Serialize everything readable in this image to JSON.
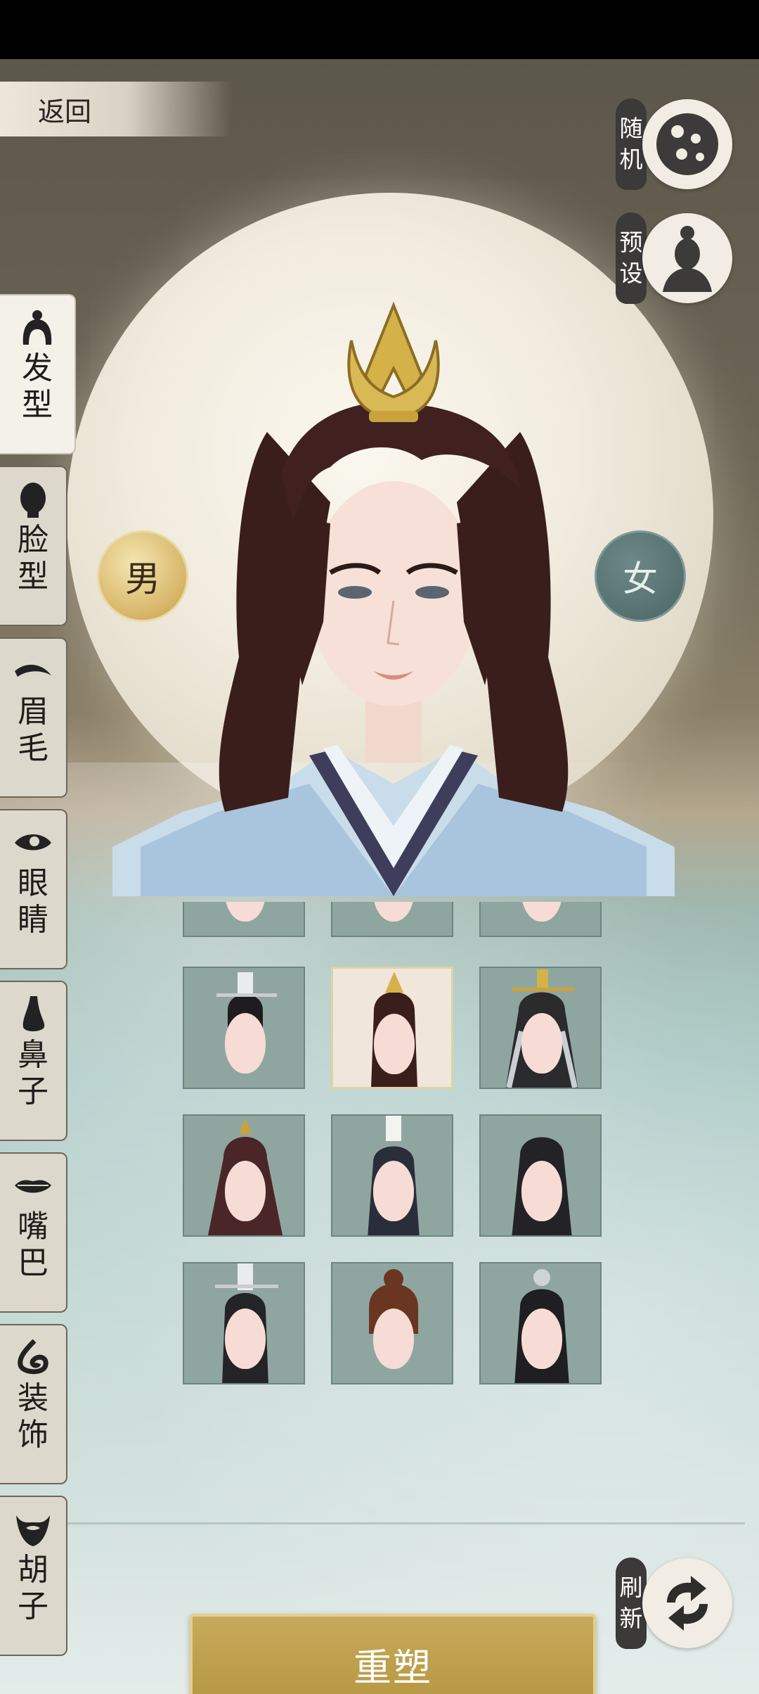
{
  "nav": {
    "back_label": "返回"
  },
  "side_buttons": {
    "random": {
      "label_1": "随",
      "label_2": "机",
      "icon": "dice-icon"
    },
    "preset": {
      "label_1": "预",
      "label_2": "设",
      "icon": "silhouette-icon"
    },
    "refresh": {
      "label_1": "刷",
      "label_2": "新",
      "icon": "refresh-icon"
    }
  },
  "gender": {
    "male": "男",
    "female": "女",
    "selected": "male"
  },
  "tabs": [
    {
      "c1": "发",
      "c2": "型",
      "icon": "hair-icon",
      "active": true
    },
    {
      "c1": "脸",
      "c2": "型",
      "icon": "face-icon",
      "active": false
    },
    {
      "c1": "眉",
      "c2": "毛",
      "icon": "eyebrow-icon",
      "active": false
    },
    {
      "c1": "眼",
      "c2": "睛",
      "icon": "eye-icon",
      "active": false
    },
    {
      "c1": "鼻",
      "c2": "子",
      "icon": "nose-icon",
      "active": false
    },
    {
      "c1": "嘴",
      "c2": "巴",
      "icon": "mouth-icon",
      "active": false
    },
    {
      "c1": "装",
      "c2": "饰",
      "icon": "ornament-icon",
      "active": false
    },
    {
      "c1": "胡",
      "c2": "子",
      "icon": "beard-icon",
      "active": false
    }
  ],
  "hairstyles": {
    "selected_index": 4,
    "count": 12
  },
  "actions": {
    "confirm_label": "重塑"
  }
}
